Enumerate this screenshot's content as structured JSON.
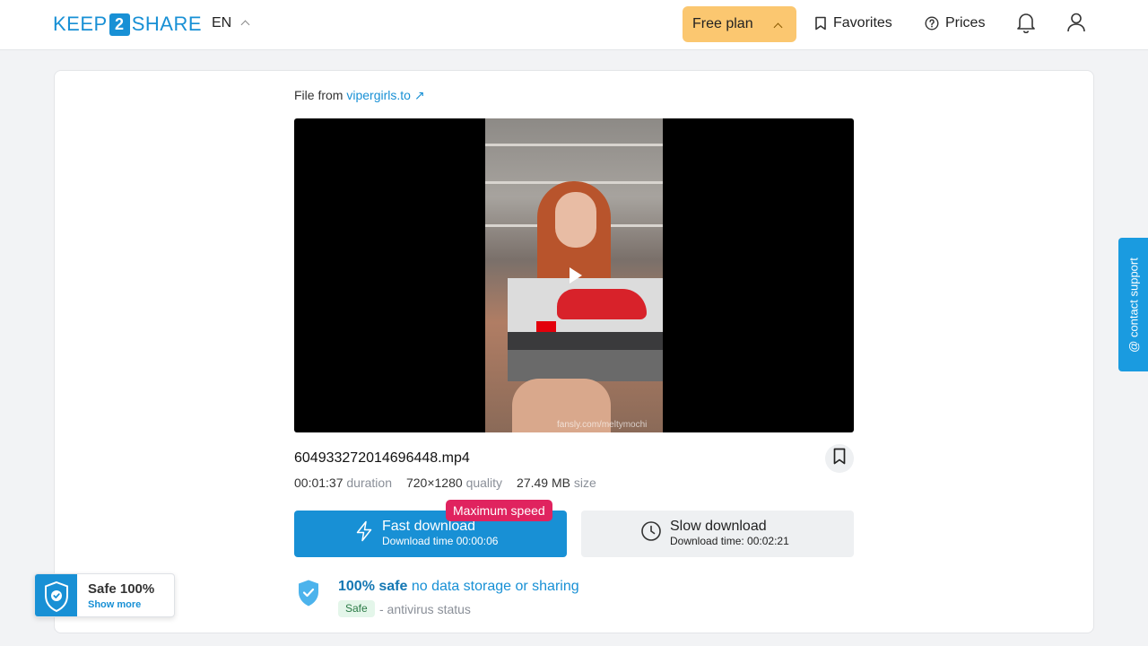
{
  "header": {
    "logo_pre": "KEEP",
    "logo_mid": "2",
    "logo_post": "SHARE",
    "language": "EN",
    "plan_label": "Free plan",
    "favorites_label": "Favorites",
    "prices_label": "Prices"
  },
  "file": {
    "from_label": "File from",
    "source_link": "vipergirls.to",
    "name": "604933272014696448.mp4",
    "duration": "00:01:37",
    "duration_label": "duration",
    "quality": "720×1280",
    "quality_label": "quality",
    "size": "27.49 MB",
    "size_label": "size",
    "video_watermark": "fansly.com/meltymochi"
  },
  "download": {
    "badge": "Maximum speed",
    "fast_title": "Fast download",
    "fast_sub": "Download time 00:00:06",
    "slow_title": "Slow download",
    "slow_sub": "Download time: 00:02:21"
  },
  "safety": {
    "title_bold": "100% safe",
    "title_rest": " no data storage or sharing",
    "tag": "Safe",
    "desc": "- antivirus status"
  },
  "widget": {
    "title": "Safe 100%",
    "link": "Show more"
  },
  "support": {
    "label": "@ contact support"
  },
  "colors": {
    "accent": "#1890d5",
    "plan": "#fbc770",
    "badge": "#e0235f"
  }
}
